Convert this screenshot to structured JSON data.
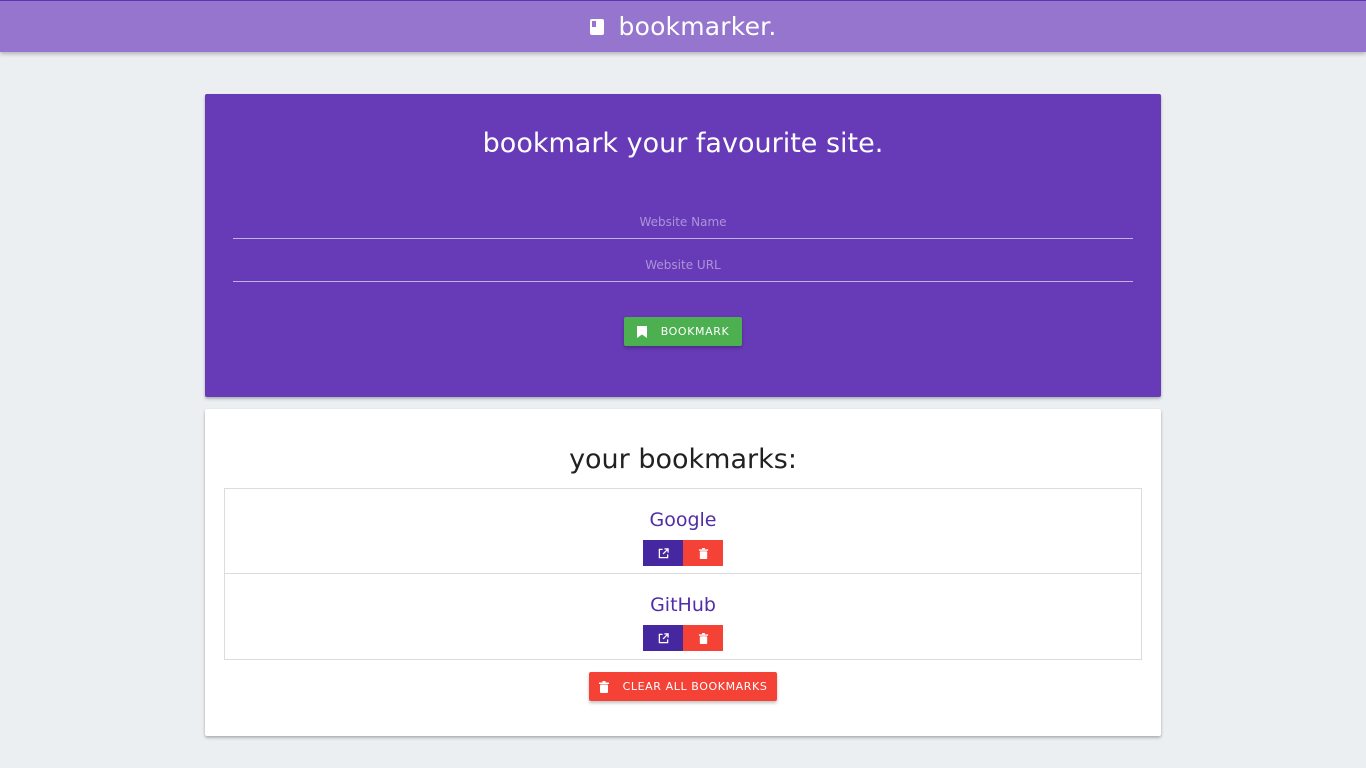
{
  "navbar": {
    "brand_icon": "book-icon",
    "brand_text": "bookmarker."
  },
  "form": {
    "title": "bookmark your favourite site.",
    "name_placeholder": "Website Name",
    "url_placeholder": "Website URL",
    "submit_label": "bookmark",
    "submit_icon": "bookmark-icon"
  },
  "bookmarks": {
    "title": "your bookmarks:",
    "items": [
      {
        "name": "Google"
      },
      {
        "name": "GitHub"
      }
    ],
    "clear_label": "clear all bookmarks",
    "clear_icon": "trash-icon"
  },
  "colors": {
    "navbar": "#9575cd",
    "primary": "#673ab7",
    "visit": "#4527a0",
    "success": "#4caf50",
    "danger": "#f44336"
  }
}
